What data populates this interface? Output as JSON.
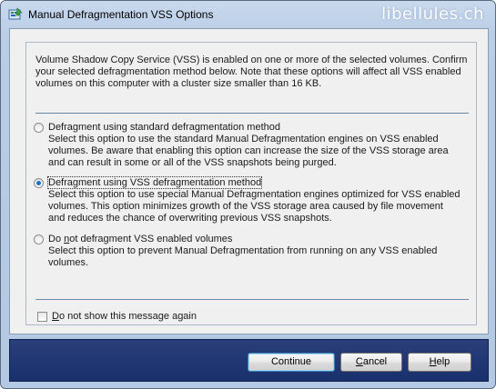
{
  "window": {
    "title": "Manual Defragmentation VSS Options",
    "watermark": "libellules.ch"
  },
  "intro_text": "Volume Shadow Copy Service (VSS) is enabled on one or more of the selected volumes. Confirm your selected defragmentation method below. Note that these options will affect all VSS enabled volumes on this computer with a cluster size smaller than 16 KB.",
  "options": [
    {
      "label": "Defragment using standard defragmentation method",
      "description": "Select this option to use the standard Manual Defragmentation engines on VSS enabled volumes. Be aware that enabling this option can increase the size of the VSS storage area and can result in some or all of the VSS snapshots being purged.",
      "selected": false
    },
    {
      "label": "Defragment using VSS defragmentation method",
      "description": "Select this option to use special Manual Defragmentation engines optimized for VSS enabled volumes. This option minimizes growth of the VSS storage area caused by file movement and reduces the chance of overwriting previous VSS snapshots.",
      "selected": true
    },
    {
      "label_prefix": "Do ",
      "label_underlined": "n",
      "label_suffix": "ot defragment VSS enabled volumes",
      "description": "Select this option to prevent Manual Defragmentation from running on any VSS enabled volumes.",
      "selected": false
    }
  ],
  "dont_show": {
    "label_underlined": "D",
    "label_rest": "o not show this message again",
    "checked": false
  },
  "buttons": {
    "continue": "Continue",
    "cancel_underlined": "C",
    "cancel_rest": "ancel",
    "help_underlined": "H",
    "help_rest": "elp"
  }
}
